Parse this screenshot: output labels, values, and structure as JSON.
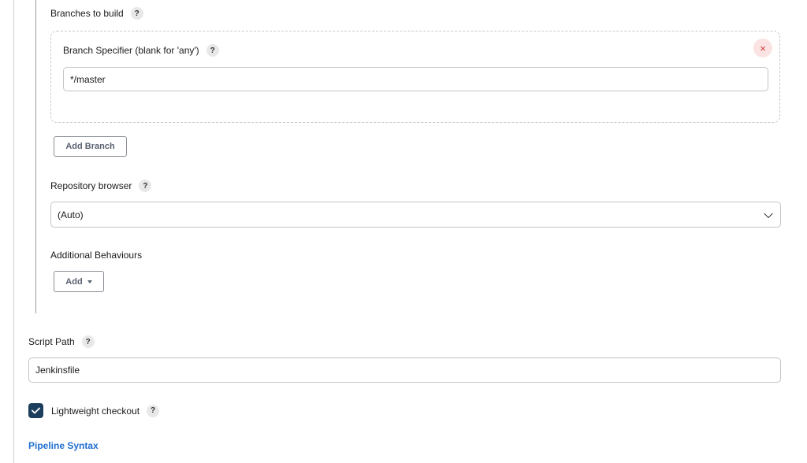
{
  "branches": {
    "section_label": "Branches to build",
    "specifier_label": "Branch Specifier (blank for 'any')",
    "specifier_value": "*/master",
    "remove_symbol": "×",
    "add_branch_label": "Add Branch"
  },
  "repository_browser": {
    "label": "Repository browser",
    "selected_value": "(Auto)"
  },
  "additional_behaviours": {
    "label": "Additional Behaviours",
    "add_label": "Add"
  },
  "script_path": {
    "label": "Script Path",
    "value": "Jenkinsfile"
  },
  "lightweight_checkout": {
    "label": "Lightweight checkout",
    "checked": true
  },
  "pipeline_syntax_link": "Pipeline Syntax",
  "help_symbol": "?",
  "colors": {
    "checkbox": "#1c3e5c",
    "link": "#1f6fd1",
    "remove_bg": "#fbe3e3",
    "remove_fg": "#d63c3c"
  }
}
